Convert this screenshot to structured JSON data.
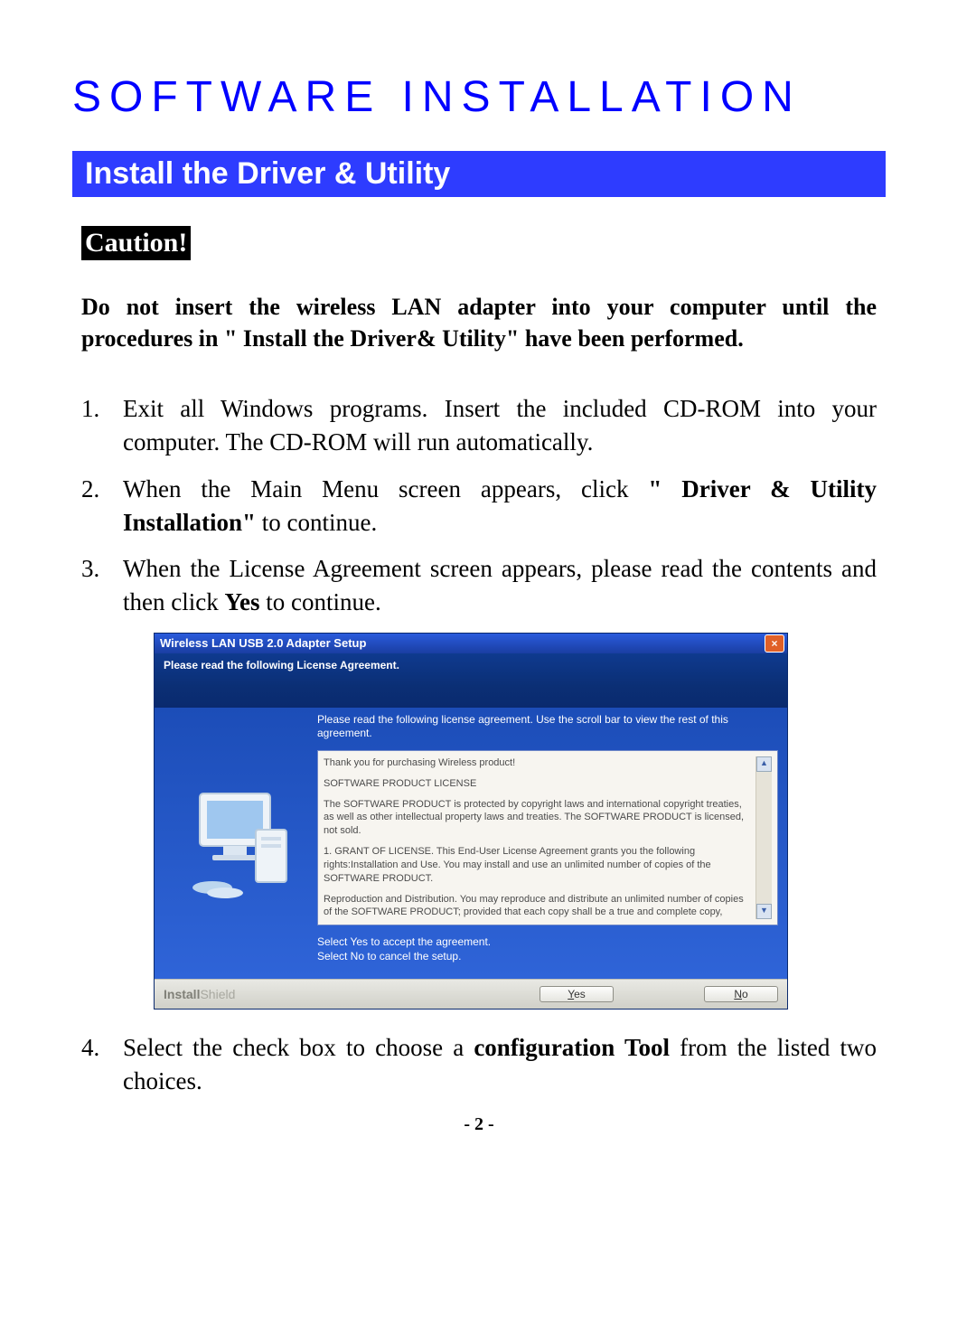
{
  "title": "SOFTWARE INSTALLATION",
  "subhead": "Install the Driver & Utility",
  "caution": "Caution!",
  "warning": "Do not insert the wireless LAN adapter into your computer until the procedures in \" Install the Driver& Utility\" have been performed.",
  "steps": {
    "s1num": "1.",
    "s1": "Exit all Windows programs. Insert the included CD-ROM into your computer. The CD-ROM will run automatically.",
    "s2num": "2.",
    "s2a": "When the Main Menu screen appears, click ",
    "s2b": "\" Driver & Utility Installation\"",
    "s2c": " to continue.",
    "s3num": "3.",
    "s3a": "When the License Agreement screen appears, please read the contents and then click ",
    "s3b": "Yes",
    "s3c": " to continue.",
    "s4num": "4.",
    "s4a": "Select the check box to choose a ",
    "s4b": "configuration Tool",
    "s4c": " from the listed two choices."
  },
  "dialog": {
    "title": "Wireless LAN USB 2.0 Adapter Setup",
    "close": "×",
    "header": "Please read the following License Agreement.",
    "instr": "Please read the following license agreement. Use the scroll bar to view the rest of this agreement.",
    "license": {
      "p1": "Thank you for purchasing Wireless product!",
      "p2": "SOFTWARE PRODUCT LICENSE",
      "p3": "The SOFTWARE PRODUCT is protected by copyright laws and international copyright treaties, as well as other intellectual property laws and treaties. The SOFTWARE PRODUCT is licensed, not sold.",
      "p4": "1. GRANT OF LICENSE. This End-User License Agreement grants you the following rights:Installation and Use. You may install and use an unlimited number of copies of the SOFTWARE PRODUCT.",
      "p5": "Reproduction and Distribution. You may reproduce and distribute an unlimited number of copies of the SOFTWARE PRODUCT; provided that each copy shall be a true and complete copy, including all copyright and trademark notices, and shall be accompanied by a copy of this EULA. Copies of the SOFTWARE PRODUCT may be distributed as a standalone product or included with your own product."
    },
    "select1": "Select Yes to accept the agreement.",
    "select2": "Select No to cancel the setup.",
    "brand1": "Install",
    "brand2": "Shield",
    "yes_u": "Y",
    "yes": "es",
    "no_u": "N",
    "no": "o",
    "scroll_up": "▲",
    "scroll_down": "▼"
  },
  "pagenum": "- 2 -"
}
